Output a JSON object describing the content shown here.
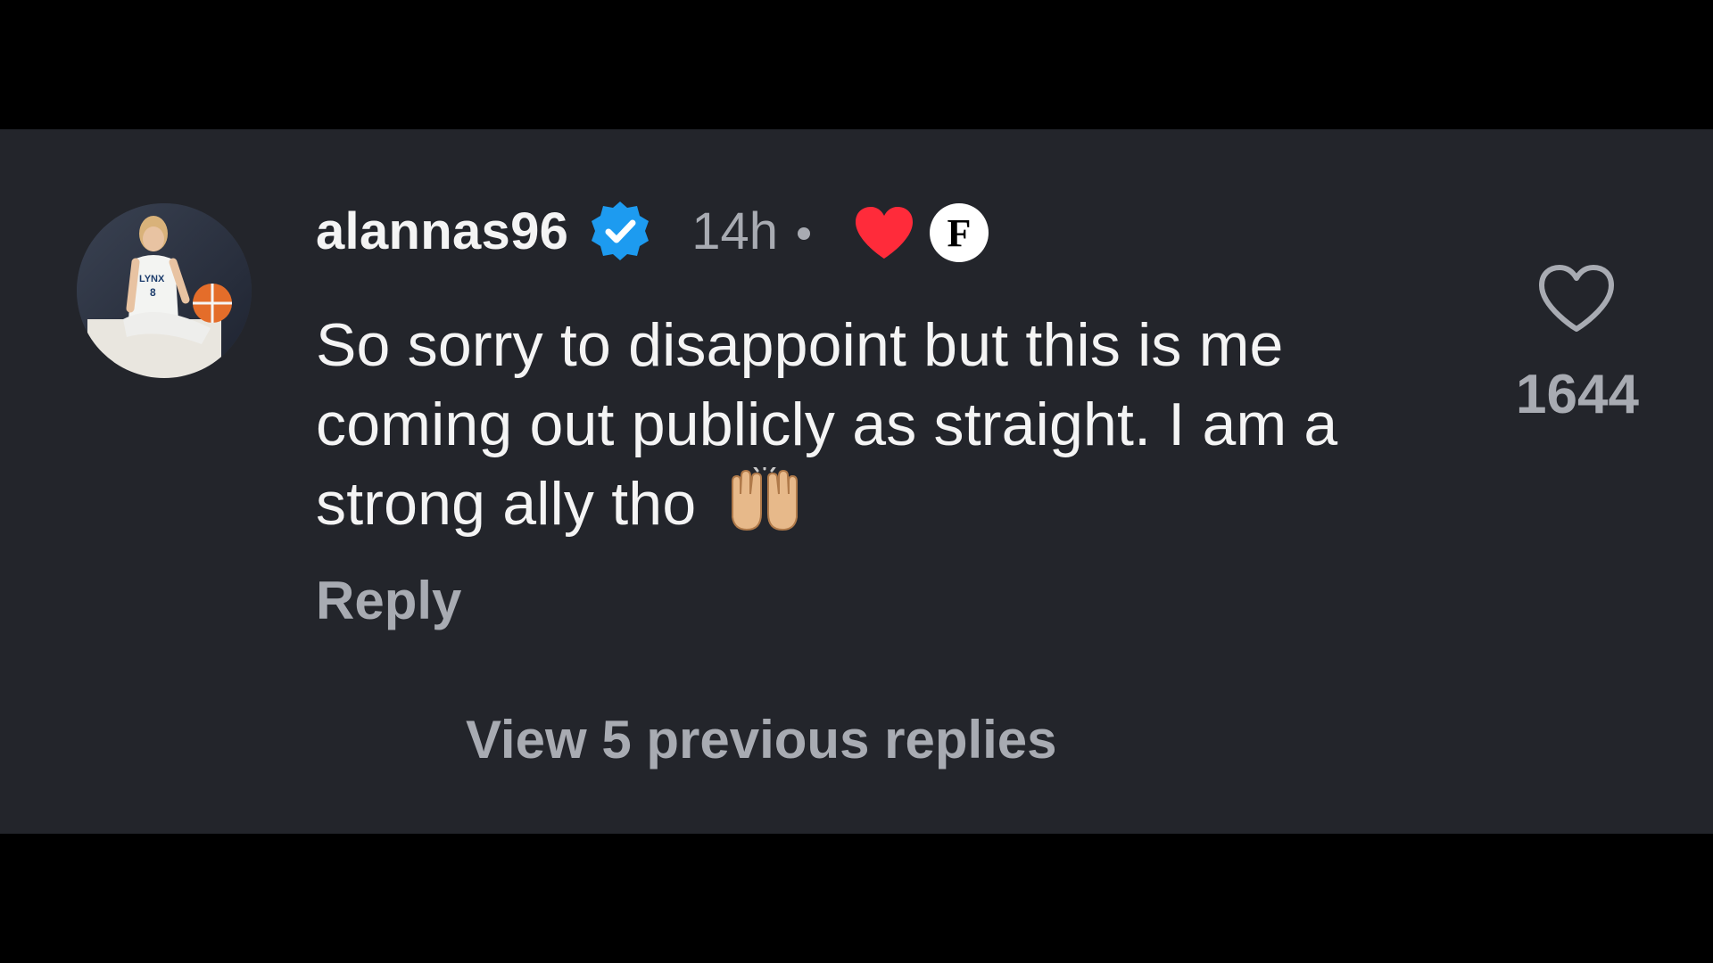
{
  "comment": {
    "username": "alannas96",
    "time": "14h",
    "creator_badge_letter": "F",
    "text": "So sorry to disappoint but this is me coming out publicly as straight. I am a strong ally tho",
    "emoji_name": "raising-hands-icon",
    "reply_label": "Reply",
    "like_count": "1644",
    "view_replies_label": "View 5 previous replies"
  },
  "colors": {
    "panel_bg": "#23252b",
    "verified_blue": "#1d9bf0",
    "heart_red": "#ff2b3a",
    "muted_text": "#a8abb2"
  }
}
